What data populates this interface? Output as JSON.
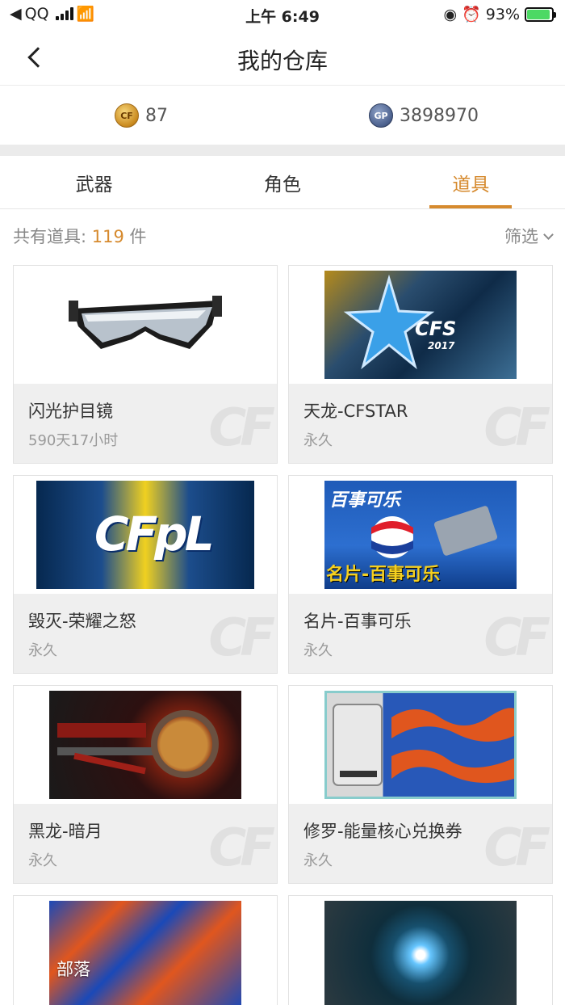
{
  "status_bar": {
    "carrier": "QQ",
    "time": "上午 6:49",
    "battery": "93%",
    "battery_level": 0.93
  },
  "nav": {
    "title": "我的仓库"
  },
  "currency": {
    "cf_points": "87",
    "gp_points": "3898970",
    "cf_icon_label": "CF",
    "gp_icon_label": "GP"
  },
  "tabs": [
    {
      "label": "武器",
      "active": false
    },
    {
      "label": "角色",
      "active": false
    },
    {
      "label": "道具",
      "active": true
    }
  ],
  "summary": {
    "prefix": "共有道具:",
    "count": "119",
    "suffix": "件",
    "filter_label": "筛选"
  },
  "accent_color": "#d68a2e",
  "items": [
    {
      "name": "闪光护目镜",
      "duration": "590天17小时"
    },
    {
      "name": "天龙-CFSTAR",
      "duration": "永久"
    },
    {
      "name": "毁灭-荣耀之怒",
      "duration": "永久"
    },
    {
      "name": "名片-百事可乐",
      "duration": "永久"
    },
    {
      "name": "黑龙-暗月",
      "duration": "永久"
    },
    {
      "name": "修罗-能量核心兑换券",
      "duration": "永久"
    }
  ],
  "artwork_text": {
    "cfs": "CFS",
    "cfs_year": "2017",
    "cfpl": "CFpL",
    "pepsi_top": "百事可乐",
    "pepsi_bottom": "名片-百事可乐"
  },
  "watermark": "CF",
  "tribe_label": "部落"
}
